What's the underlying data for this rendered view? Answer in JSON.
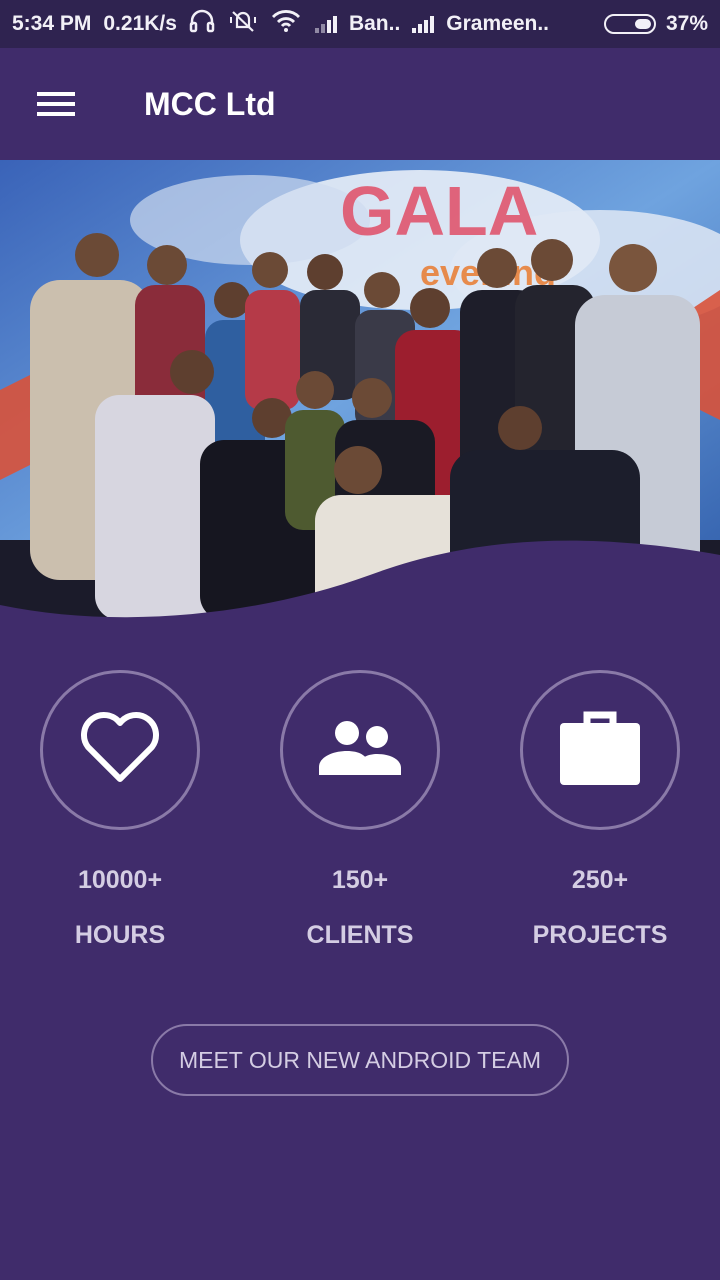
{
  "status_bar": {
    "time": "5:34 PM",
    "speed": "0.21K/s",
    "carrier1": "Ban..",
    "carrier2": "Grameen..",
    "battery": "37%",
    "icons": [
      "headphones-icon",
      "mute-vibrate-icon",
      "wifi-icon",
      "signal-icon",
      "signal-icon",
      "battery-icon"
    ]
  },
  "app_bar": {
    "title": "MCC Ltd",
    "menu_icon": "hamburger-menu-icon"
  },
  "hero": {
    "banner_text": "GALA",
    "banner_subtext": "evening"
  },
  "stats": [
    {
      "icon": "heart-icon",
      "value": "10000+",
      "label": "HOURS"
    },
    {
      "icon": "people-icon",
      "value": "150+",
      "label": "CLIENTS"
    },
    {
      "icon": "briefcase-icon",
      "value": "250+",
      "label": "PROJECTS"
    }
  ],
  "cta": {
    "label": "MEET OUR NEW ANDROID TEAM"
  },
  "colors": {
    "background": "#402c6b",
    "status_bar": "#2f2350",
    "muted_text": "#d4cde3",
    "circle_border": "#8a7aa8"
  }
}
